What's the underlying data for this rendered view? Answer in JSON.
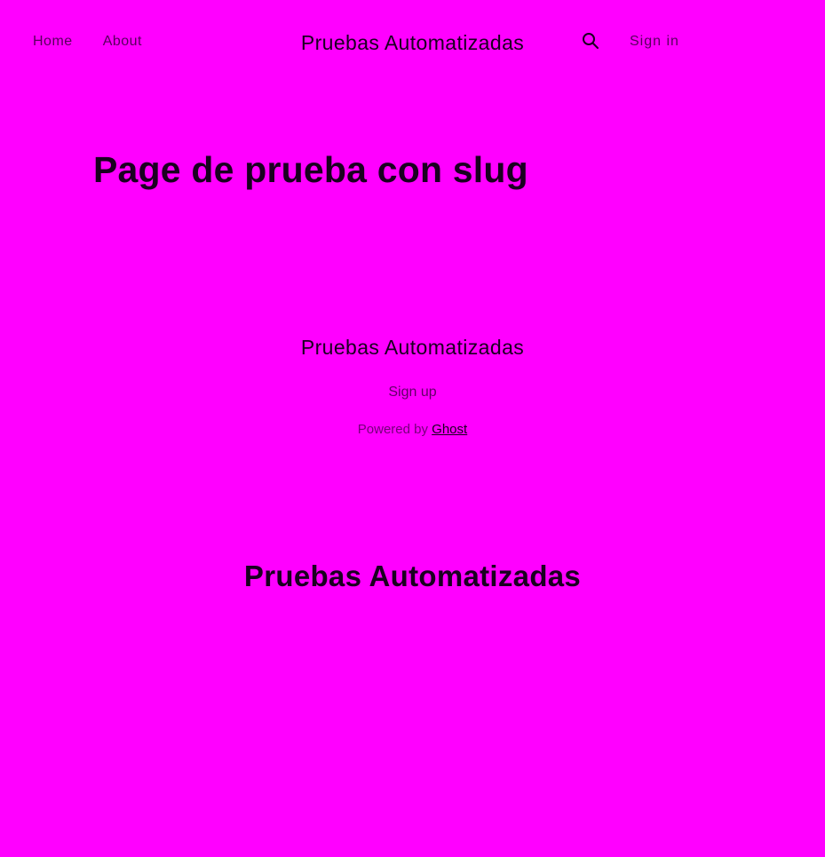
{
  "header": {
    "nav": [
      {
        "label": "Home"
      },
      {
        "label": "About"
      }
    ],
    "site_title": "Pruebas Automatizadas",
    "search_icon": "search-icon",
    "signin_label": "Sign in"
  },
  "main": {
    "page_title": "Page de prueba con slug"
  },
  "footer": {
    "site_title": "Pruebas Automatizadas",
    "signup_label": "Sign up",
    "powered_by_label": "Powered by",
    "powered_by_link": "Ghost"
  },
  "brand_heading": "Pruebas Automatizadas",
  "colors": {
    "background": "#ff00ff",
    "text": "#1a0020"
  }
}
